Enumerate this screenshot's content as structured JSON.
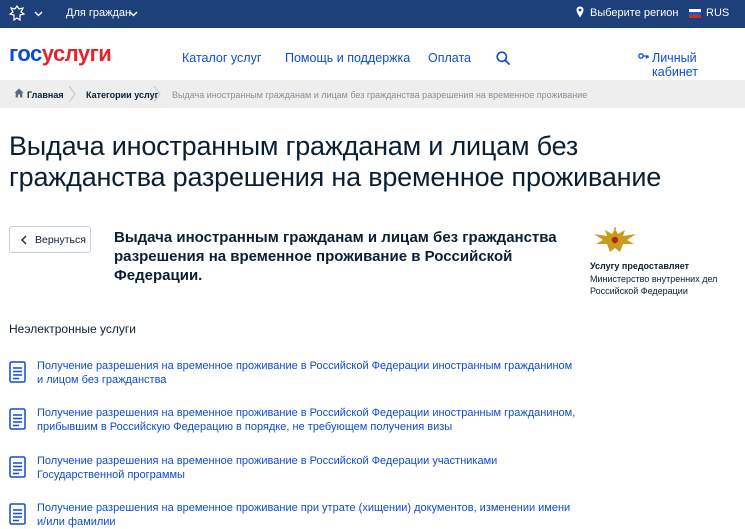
{
  "topbar": {
    "for_citizens": "Для граждан",
    "region": "Выберите регион",
    "lang": "RUS"
  },
  "logo": {
    "part1": "гос",
    "part2": "услуги"
  },
  "nav": {
    "catalog": "Каталог услуг",
    "help": "Помощь и поддержка",
    "payment": "Оплата",
    "cabinet": "Личный кабинет"
  },
  "breadcrumb": {
    "home": "Главная",
    "categories": "Категории услуг",
    "current": "Выдача иностранным гражданам и лицам без гражданства разрешения на временное проживание"
  },
  "page": {
    "title": "Выдача иностранным гражданам и лицам без гражданства разрешения на временное проживание",
    "back_label": "Вернуться",
    "service_title": "Выдача иностранным гражданам и лицам без гражданства разрешения на временное проживание в Российской Федерации."
  },
  "provider": {
    "label": "Услугу предоставляет",
    "name": "Министерство внутренних дел Российской Федерации"
  },
  "section": {
    "title": "Неэлектронные услуги",
    "items": [
      "Получение разрешения на временное проживание в Российской Федерации иностранным гражданином и лицом без гражданства",
      "Получение разрешения на временное проживание в Российской Федерации иностранным гражданином, прибывшим в Российскую Федерацию в порядке, не требующем получения визы",
      "Получение разрешения на временное проживание в Российской Федерации участниками Государственной программы",
      "Получение разрешения на временное проживание при утрате (хищении) документов, изменении имени и/или фамилии"
    ]
  },
  "colors": {
    "topbar": "#1d3f7a",
    "link": "#0d4cd3",
    "brand_red": "#e3242b",
    "breadcrumb_bg": "#eeeeee"
  },
  "icons": [
    "emblem-icon",
    "chevron-down-icon",
    "location-pin-icon",
    "flag-icon",
    "search-icon",
    "key-icon",
    "home-icon",
    "arrow-left-icon",
    "document-icon",
    "mvd-emblem-icon"
  ]
}
